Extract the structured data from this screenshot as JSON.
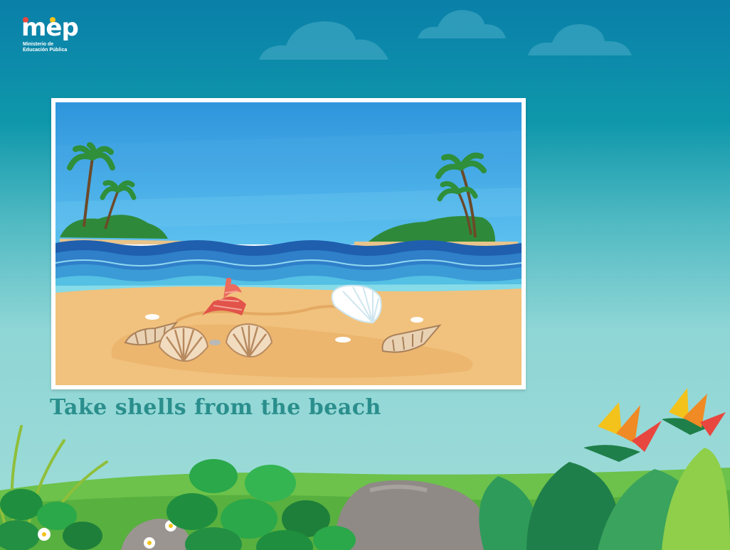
{
  "logo": {
    "wordmark": "mep",
    "line1": "Ministerio de",
    "line2": "Educación Pública"
  },
  "caption": "Take shells from the beach",
  "colors": {
    "caption": "#2a8f8c",
    "sky_top": "#0a7fa9",
    "sky_bottom": "#9fdcd8",
    "sand": "#f1c27d",
    "sea": "#2f7fc9"
  }
}
